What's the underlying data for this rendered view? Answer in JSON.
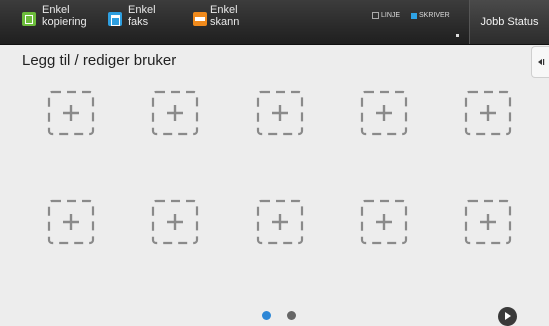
{
  "top_bar": {
    "apps": [
      {
        "line1": "Enkel",
        "line2": "kopiering",
        "icon": "copy-icon",
        "color": "#6cbd3b"
      },
      {
        "line1": "Enkel",
        "line2": "faks",
        "icon": "fax-icon",
        "color": "#2e9fe0"
      },
      {
        "line1": "Enkel",
        "line2": "skann",
        "icon": "scan-icon",
        "color": "#f08a1c"
      }
    ],
    "status": {
      "line_label": "LINJE",
      "printer_label": "SKRIVER",
      "printer_color": "#2ea3e6"
    },
    "job_status_label": "Jobb Status"
  },
  "page": {
    "title": "Legg til / rediger bruker",
    "side_tab_icon": "collapse-left-icon"
  },
  "grid": {
    "slot_icon": "add-icon",
    "slot_count": 10
  },
  "pagination": {
    "current_page": 1,
    "total_pages": 2,
    "active_color": "#2e87d6",
    "next_icon": "next-arrow-icon"
  }
}
